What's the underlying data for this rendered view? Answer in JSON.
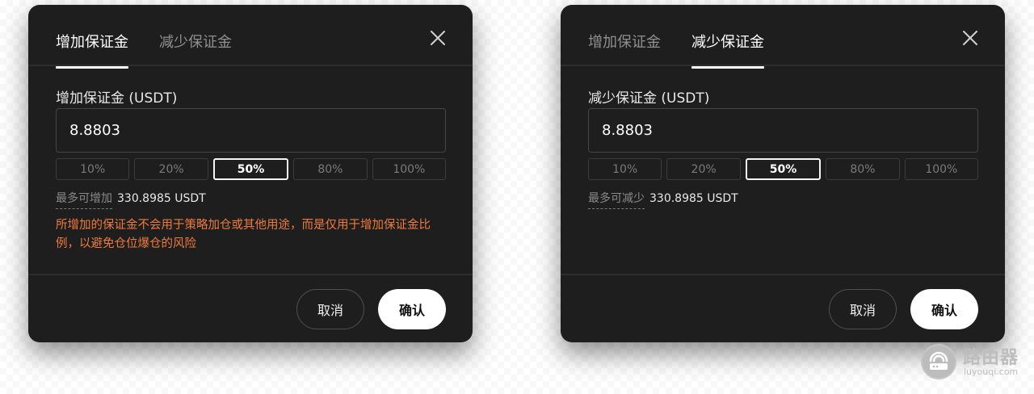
{
  "add_modal": {
    "tabs": [
      {
        "label": "增加保证金",
        "active": true
      },
      {
        "label": "减少保证金",
        "active": false
      }
    ],
    "field_label": "增加保证金 (USDT)",
    "amount": "8.8803",
    "percentages": [
      "10%",
      "20%",
      "50%",
      "80%",
      "100%"
    ],
    "selected_percentage": "50%",
    "max_label": "最多可增加",
    "max_value": "330.8985 USDT",
    "warning": "所增加的保证金不会用于策略加仓或其他用途，而是仅用于增加保证金比例，以避免仓位爆仓的风险",
    "cancel_label": "取消",
    "confirm_label": "确认"
  },
  "reduce_modal": {
    "tabs": [
      {
        "label": "增加保证金",
        "active": false
      },
      {
        "label": "减少保证金",
        "active": true
      }
    ],
    "field_label": "减少保证金 (USDT)",
    "amount": "8.8803",
    "percentages": [
      "10%",
      "20%",
      "50%",
      "80%",
      "100%"
    ],
    "selected_percentage": "50%",
    "max_label": "最多可减少",
    "max_value": "330.8985 USDT",
    "cancel_label": "取消",
    "confirm_label": "确认"
  },
  "watermark": {
    "title": "路由器",
    "subtitle": "luyouqi.com",
    "icon": "router-logo-icon"
  },
  "colors": {
    "modal_bg": "#1e1e1e",
    "warning": "#f07a3d",
    "active_text": "#ffffff",
    "muted_text": "#8f8f8f"
  }
}
